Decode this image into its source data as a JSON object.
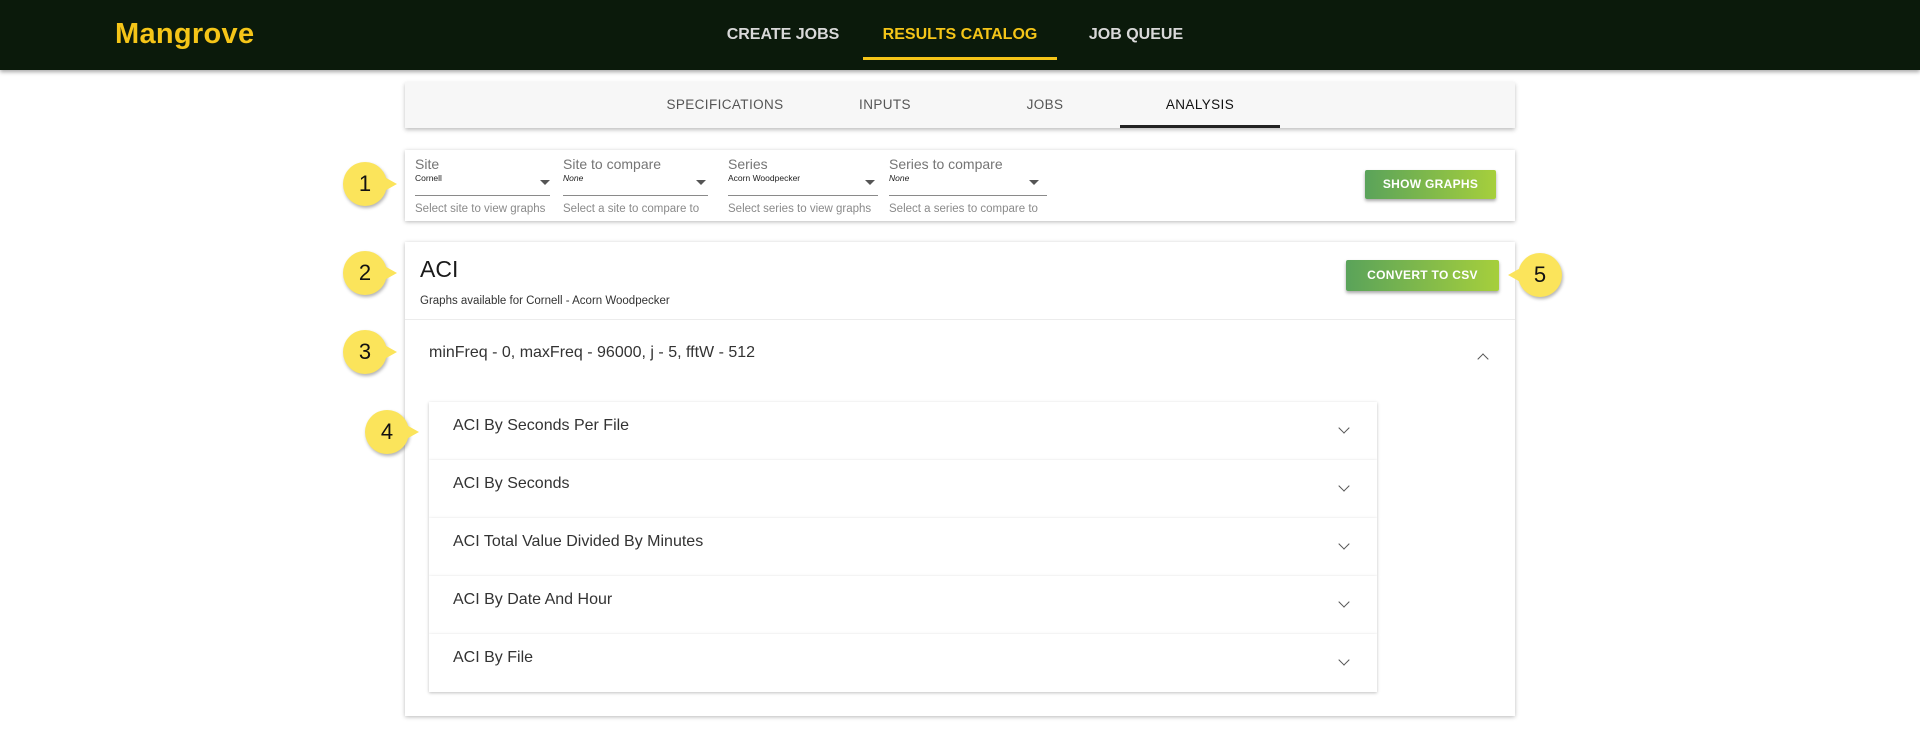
{
  "app": {
    "brand": "Mangrove"
  },
  "nav": {
    "items": [
      {
        "label": "CREATE JOBS"
      },
      {
        "label": "RESULTS CATALOG",
        "active": true
      },
      {
        "label": "JOB QUEUE"
      }
    ]
  },
  "subnav": {
    "tabs": [
      {
        "label": "SPECIFICATIONS"
      },
      {
        "label": "INPUTS"
      },
      {
        "label": "JOBS"
      },
      {
        "label": "ANALYSIS",
        "active": true
      }
    ]
  },
  "filters": {
    "site": {
      "label": "Site",
      "value": "Cornell",
      "hint": "Select site to view graphs"
    },
    "site_compare": {
      "label": "Site to compare",
      "value": "None",
      "hint": "Select a site to compare to"
    },
    "series": {
      "label": "Series",
      "value": "Acorn Woodpecker",
      "hint": "Select series to view graphs"
    },
    "series_compare": {
      "label": "Series to compare",
      "value": "None",
      "hint": "Select a series to compare to"
    },
    "show_graphs_label": "SHOW GRAPHS"
  },
  "results": {
    "title": "ACI",
    "subtitle": "Graphs available for Cornell - Acorn Woodpecker",
    "convert_label": "CONVERT TO CSV",
    "param_set": "minFreq - 0, maxFreq - 96000, j - 5, fftW - 512",
    "graphs": [
      {
        "label": "ACI By Seconds Per File"
      },
      {
        "label": "ACI By Seconds"
      },
      {
        "label": "ACI Total Value Divided By Minutes"
      },
      {
        "label": "ACI By Date And Hour"
      },
      {
        "label": "ACI By File"
      }
    ]
  },
  "callouts": [
    "1",
    "2",
    "3",
    "4",
    "5"
  ],
  "colors": {
    "navbar": "#0b1a0b",
    "brand": "#f5c518",
    "callout": "#fbe45b",
    "button_start": "#5aa35a",
    "button_end": "#a6cf3c"
  }
}
